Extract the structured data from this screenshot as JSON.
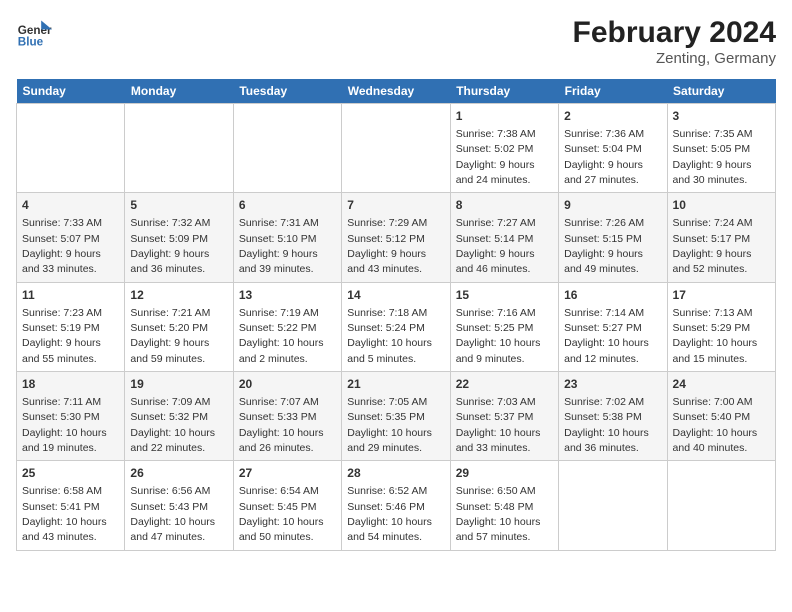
{
  "header": {
    "logo_line1": "General",
    "logo_line2": "Blue",
    "title": "February 2024",
    "subtitle": "Zenting, Germany"
  },
  "weekdays": [
    "Sunday",
    "Monday",
    "Tuesday",
    "Wednesday",
    "Thursday",
    "Friday",
    "Saturday"
  ],
  "weeks": [
    [
      {
        "day": "",
        "info": ""
      },
      {
        "day": "",
        "info": ""
      },
      {
        "day": "",
        "info": ""
      },
      {
        "day": "",
        "info": ""
      },
      {
        "day": "1",
        "info": "Sunrise: 7:38 AM\nSunset: 5:02 PM\nDaylight: 9 hours and 24 minutes."
      },
      {
        "day": "2",
        "info": "Sunrise: 7:36 AM\nSunset: 5:04 PM\nDaylight: 9 hours and 27 minutes."
      },
      {
        "day": "3",
        "info": "Sunrise: 7:35 AM\nSunset: 5:05 PM\nDaylight: 9 hours and 30 minutes."
      }
    ],
    [
      {
        "day": "4",
        "info": "Sunrise: 7:33 AM\nSunset: 5:07 PM\nDaylight: 9 hours and 33 minutes."
      },
      {
        "day": "5",
        "info": "Sunrise: 7:32 AM\nSunset: 5:09 PM\nDaylight: 9 hours and 36 minutes."
      },
      {
        "day": "6",
        "info": "Sunrise: 7:31 AM\nSunset: 5:10 PM\nDaylight: 9 hours and 39 minutes."
      },
      {
        "day": "7",
        "info": "Sunrise: 7:29 AM\nSunset: 5:12 PM\nDaylight: 9 hours and 43 minutes."
      },
      {
        "day": "8",
        "info": "Sunrise: 7:27 AM\nSunset: 5:14 PM\nDaylight: 9 hours and 46 minutes."
      },
      {
        "day": "9",
        "info": "Sunrise: 7:26 AM\nSunset: 5:15 PM\nDaylight: 9 hours and 49 minutes."
      },
      {
        "day": "10",
        "info": "Sunrise: 7:24 AM\nSunset: 5:17 PM\nDaylight: 9 hours and 52 minutes."
      }
    ],
    [
      {
        "day": "11",
        "info": "Sunrise: 7:23 AM\nSunset: 5:19 PM\nDaylight: 9 hours and 55 minutes."
      },
      {
        "day": "12",
        "info": "Sunrise: 7:21 AM\nSunset: 5:20 PM\nDaylight: 9 hours and 59 minutes."
      },
      {
        "day": "13",
        "info": "Sunrise: 7:19 AM\nSunset: 5:22 PM\nDaylight: 10 hours and 2 minutes."
      },
      {
        "day": "14",
        "info": "Sunrise: 7:18 AM\nSunset: 5:24 PM\nDaylight: 10 hours and 5 minutes."
      },
      {
        "day": "15",
        "info": "Sunrise: 7:16 AM\nSunset: 5:25 PM\nDaylight: 10 hours and 9 minutes."
      },
      {
        "day": "16",
        "info": "Sunrise: 7:14 AM\nSunset: 5:27 PM\nDaylight: 10 hours and 12 minutes."
      },
      {
        "day": "17",
        "info": "Sunrise: 7:13 AM\nSunset: 5:29 PM\nDaylight: 10 hours and 15 minutes."
      }
    ],
    [
      {
        "day": "18",
        "info": "Sunrise: 7:11 AM\nSunset: 5:30 PM\nDaylight: 10 hours and 19 minutes."
      },
      {
        "day": "19",
        "info": "Sunrise: 7:09 AM\nSunset: 5:32 PM\nDaylight: 10 hours and 22 minutes."
      },
      {
        "day": "20",
        "info": "Sunrise: 7:07 AM\nSunset: 5:33 PM\nDaylight: 10 hours and 26 minutes."
      },
      {
        "day": "21",
        "info": "Sunrise: 7:05 AM\nSunset: 5:35 PM\nDaylight: 10 hours and 29 minutes."
      },
      {
        "day": "22",
        "info": "Sunrise: 7:03 AM\nSunset: 5:37 PM\nDaylight: 10 hours and 33 minutes."
      },
      {
        "day": "23",
        "info": "Sunrise: 7:02 AM\nSunset: 5:38 PM\nDaylight: 10 hours and 36 minutes."
      },
      {
        "day": "24",
        "info": "Sunrise: 7:00 AM\nSunset: 5:40 PM\nDaylight: 10 hours and 40 minutes."
      }
    ],
    [
      {
        "day": "25",
        "info": "Sunrise: 6:58 AM\nSunset: 5:41 PM\nDaylight: 10 hours and 43 minutes."
      },
      {
        "day": "26",
        "info": "Sunrise: 6:56 AM\nSunset: 5:43 PM\nDaylight: 10 hours and 47 minutes."
      },
      {
        "day": "27",
        "info": "Sunrise: 6:54 AM\nSunset: 5:45 PM\nDaylight: 10 hours and 50 minutes."
      },
      {
        "day": "28",
        "info": "Sunrise: 6:52 AM\nSunset: 5:46 PM\nDaylight: 10 hours and 54 minutes."
      },
      {
        "day": "29",
        "info": "Sunrise: 6:50 AM\nSunset: 5:48 PM\nDaylight: 10 hours and 57 minutes."
      },
      {
        "day": "",
        "info": ""
      },
      {
        "day": "",
        "info": ""
      }
    ]
  ]
}
